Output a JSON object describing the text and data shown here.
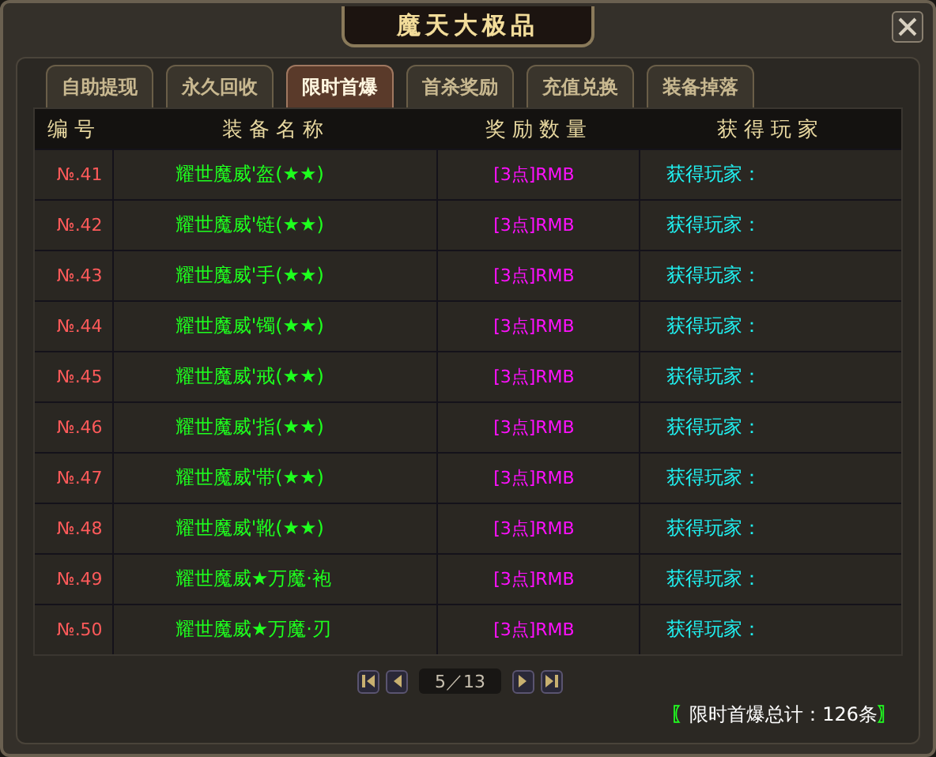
{
  "window": {
    "title": "魔天大极品"
  },
  "tabs": [
    {
      "label": "自助提现",
      "selected": false
    },
    {
      "label": "永久回收",
      "selected": false
    },
    {
      "label": "限时首爆",
      "selected": true
    },
    {
      "label": "首杀奖励",
      "selected": false
    },
    {
      "label": "充值兑换",
      "selected": false
    },
    {
      "label": "装备掉落",
      "selected": false
    }
  ],
  "table": {
    "columns": [
      "编号",
      "装备名称",
      "奖励数量",
      "获得玩家"
    ],
    "rows": [
      {
        "number": "№.41",
        "item": "耀世魔威'盔(★★)",
        "reward": "[3点]RMB",
        "player": "获得玩家："
      },
      {
        "number": "№.42",
        "item": "耀世魔威'链(★★)",
        "reward": "[3点]RMB",
        "player": "获得玩家："
      },
      {
        "number": "№.43",
        "item": "耀世魔威'手(★★)",
        "reward": "[3点]RMB",
        "player": "获得玩家："
      },
      {
        "number": "№.44",
        "item": "耀世魔威'镯(★★)",
        "reward": "[3点]RMB",
        "player": "获得玩家："
      },
      {
        "number": "№.45",
        "item": "耀世魔威'戒(★★)",
        "reward": "[3点]RMB",
        "player": "获得玩家："
      },
      {
        "number": "№.46",
        "item": "耀世魔威'指(★★)",
        "reward": "[3点]RMB",
        "player": "获得玩家："
      },
      {
        "number": "№.47",
        "item": "耀世魔威'带(★★)",
        "reward": "[3点]RMB",
        "player": "获得玩家："
      },
      {
        "number": "№.48",
        "item": "耀世魔威'靴(★★)",
        "reward": "[3点]RMB",
        "player": "获得玩家："
      },
      {
        "number": "№.49",
        "item": "耀世魔威★万魔·袍",
        "reward": "[3点]RMB",
        "player": "获得玩家："
      },
      {
        "number": "№.50",
        "item": "耀世魔威★万魔·刃",
        "reward": "[3点]RMB",
        "player": "获得玩家："
      }
    ]
  },
  "pager": {
    "page": "5／13"
  },
  "footer": {
    "open_bracket": "〖",
    "total": "限时首爆总计：126条",
    "close_bracket": "〗"
  }
}
